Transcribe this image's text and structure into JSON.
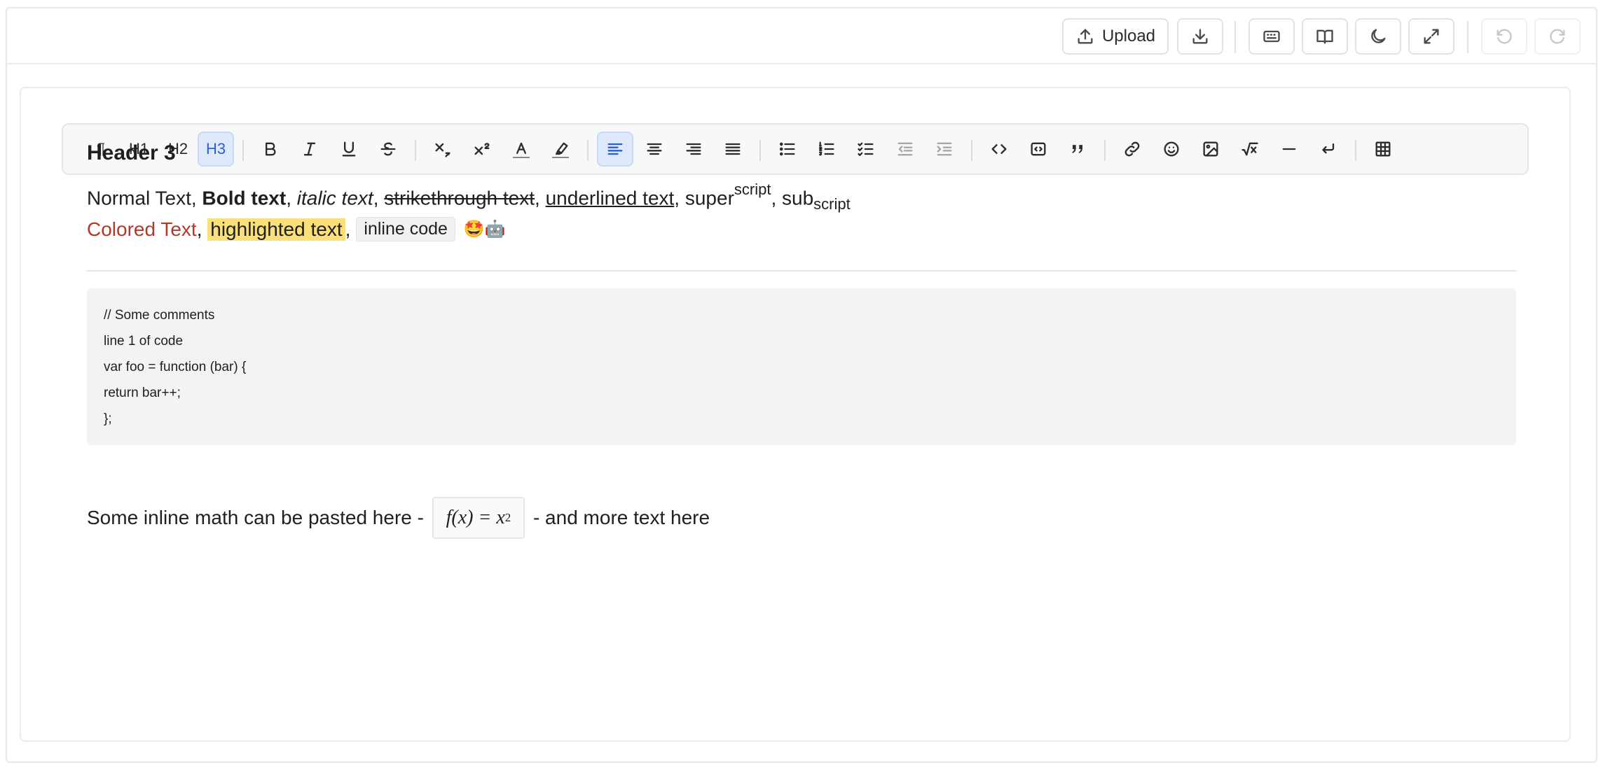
{
  "topbar": {
    "upload_label": "Upload",
    "buttons": [
      "upload",
      "download",
      "keyboard",
      "book",
      "dark-mode",
      "fullscreen",
      "undo",
      "redo"
    ]
  },
  "format_toolbar": {
    "paragraph": "¶",
    "h1": "H1",
    "h2": "H2",
    "h3": "H3",
    "active_heading": "H3",
    "active_align": "align-left",
    "text_color_glyph": "A"
  },
  "content": {
    "heading": "Header 3",
    "line1": {
      "normal": "Normal Text, ",
      "bold": "Bold text",
      "sep1": ", ",
      "italic": "italic text",
      "sep2": ", ",
      "strike": "strikethrough text",
      "sep3": ", ",
      "underline": "underlined text",
      "sep4": ", super",
      "sup": "script",
      "sep5": ", sub",
      "sub": "script"
    },
    "line2": {
      "colored": "Colored Text",
      "sep1": ", ",
      "highlighted": "highlighted text",
      "sep2": ",",
      "inline_code": "inline code",
      "emoji": "🤩🤖"
    },
    "code_lines": [
      "// Some comments",
      "line 1 of code",
      "var foo = function (bar) {",
      "return bar++;",
      "};"
    ],
    "math_line": {
      "before": "Some inline math can be pasted here -",
      "formula_fx": "f(x) = x",
      "formula_exp": "2",
      "after": "- and more text here"
    }
  },
  "colors": {
    "accent": "#2a5fd6",
    "colored_text": "#b0392b",
    "highlight": "#f9e07a"
  }
}
